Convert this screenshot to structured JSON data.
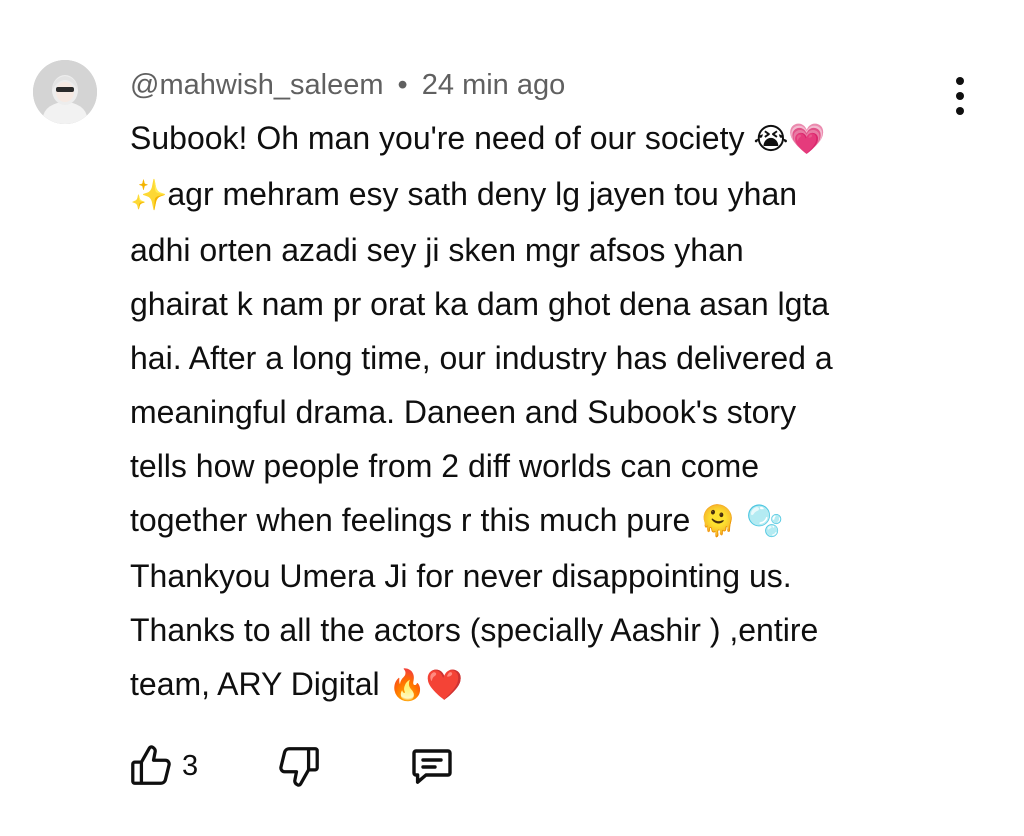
{
  "comment": {
    "author": "@mahwish_saleem",
    "separator": "•",
    "timestamp": "24 min ago",
    "lines": [
      [
        "Subook! Oh man you're  need of our society ",
        "😭💗"
      ],
      [
        "✨",
        "agr mehram esy  sath deny lg jayen tou yhan"
      ],
      [
        "adhi orten azadi sey ji sken mgr afsos yhan"
      ],
      [
        "ghairat k nam pr orat ka dam ghot dena asan lgta"
      ],
      [
        "hai. After a long time, our industry has delivered a"
      ],
      [
        "meaningful drama. Daneen and Subook's story"
      ],
      [
        "tells how people from 2 diff worlds can come"
      ],
      [
        "together when feelings r this much pure ",
        "🫠 🫧"
      ],
      [
        "Thankyou Umera Ji for never disappointing us."
      ],
      [
        "Thanks to all the actors (specially Aashir ) ,entire"
      ],
      [
        "team, ARY Digital ",
        "🔥❤️"
      ]
    ],
    "like_count": "3",
    "icons": {
      "avatar": "avatar-icon",
      "menu": "more-vert-icon",
      "like": "thumbs-up-icon",
      "dislike": "thumbs-down-icon",
      "reply": "reply-comment-icon"
    }
  }
}
